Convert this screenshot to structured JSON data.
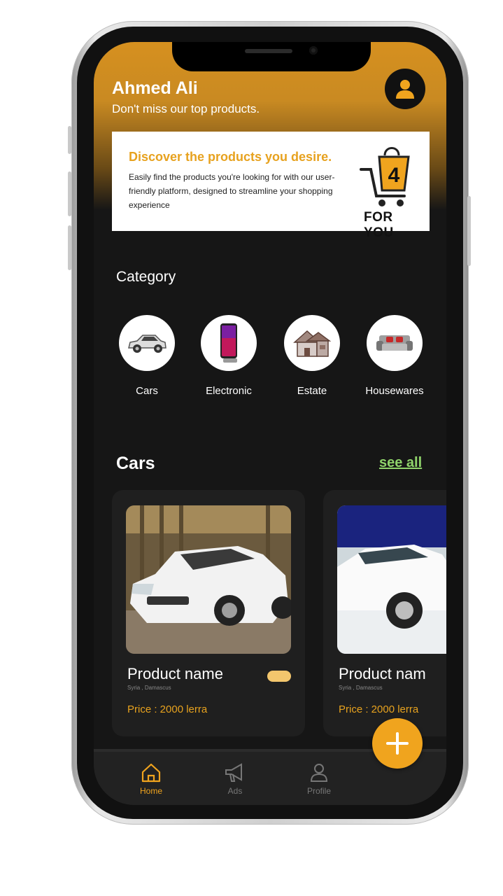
{
  "header": {
    "user_name": "Ahmed Ali",
    "subtitle": "Don't miss our top products."
  },
  "banner": {
    "title": "Discover the products you desire.",
    "text": "Easily find the products you're looking for with our user-friendly platform, designed to streamline your shopping experience",
    "logo_digit": "4",
    "logo_caption": "FOR YOU"
  },
  "category": {
    "title": "Category",
    "items": [
      {
        "label": "Cars",
        "icon": "car-icon"
      },
      {
        "label": "Electronic",
        "icon": "phone-icon"
      },
      {
        "label": "Estate",
        "icon": "house-icon"
      },
      {
        "label": "Housewares",
        "icon": "sofa-icon"
      }
    ]
  },
  "cars_section": {
    "title": "Cars",
    "see_all": "see all"
  },
  "products": [
    {
      "name": "Product name",
      "meta": "Syria , Damascus",
      "price": "Price : 2000 lerra"
    },
    {
      "name": "Product nam",
      "meta": "Syria , Damascus",
      "price": "Price : 2000 lerra"
    }
  ],
  "nav": {
    "items": [
      {
        "label": "Home",
        "icon": "home-icon",
        "active": true
      },
      {
        "label": "Ads",
        "icon": "megaphone-icon",
        "active": false
      },
      {
        "label": "Profile",
        "icon": "user-icon",
        "active": false
      }
    ]
  },
  "colors": {
    "accent": "#f0a41e",
    "background": "#161616",
    "link": "#8fd36a"
  }
}
